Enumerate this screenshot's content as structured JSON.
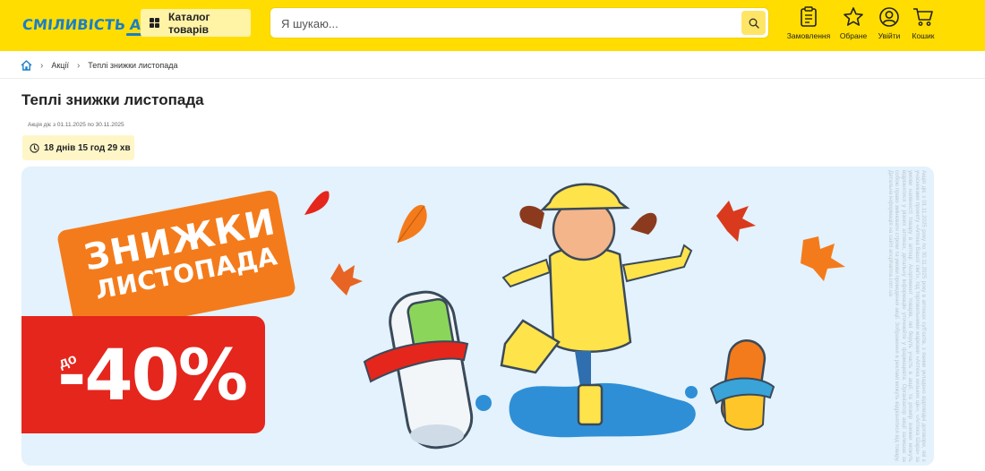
{
  "header": {
    "logo": {
      "text": "СМІЛИВІСТЬ",
      "brand": "АНЦ"
    },
    "catalog_label": "Каталог товарів",
    "search": {
      "placeholder": "Я шукаю...",
      "value": ""
    },
    "actions": [
      {
        "label": "Замовлення",
        "icon": "clipboard-icon"
      },
      {
        "label": "Обране",
        "icon": "star-icon"
      },
      {
        "label": "Увійти",
        "icon": "user-icon"
      },
      {
        "label": "Кошик",
        "icon": "cart-icon"
      }
    ]
  },
  "breadcrumb": {
    "home_icon": "home-icon",
    "items": [
      "Акції",
      "Теплі знижки листопада"
    ]
  },
  "page": {
    "title": "Теплі знижки листопада",
    "dates": "Акція діє з 01.11.2025 по 30.11.2025",
    "timer": "18 днів 15 год 29 хв"
  },
  "banner": {
    "headline_line1": "ЗНИЖКИ",
    "headline_line2": "ЛИСТОПАДА",
    "discount_prefix": "до",
    "discount": "-40%",
    "legal_text": "Акція діє з 01.11.2025 року по 30.11.2025 року в аптеках суб'єктів, з якими укладено відповідні договори, які є учасниками проекту «Аптека Вашої сім'ї», під торговельними марками «Аптека низьких цін», «Аптека Шара» за умови наявності товару в аптеці. Асортимент товарів, які беруть участь в акції, та розмір знижки можуть відрізнятися у різних аптеках, детальну інформацію уточнюйте у фармацевта. Організатор акції залишає за собою право змінювати строки та умови проведення акції. Зображення в рекламі можуть відрізнятися від товару. Детальна інформація на сайті ancpharma.com.ua"
  },
  "colors": {
    "header_bg": "#ffdd00",
    "brand_blue": "#1a7ec7",
    "banner_bg": "#e3f2fc",
    "orange": "#f47b1b",
    "red": "#e5261d"
  }
}
